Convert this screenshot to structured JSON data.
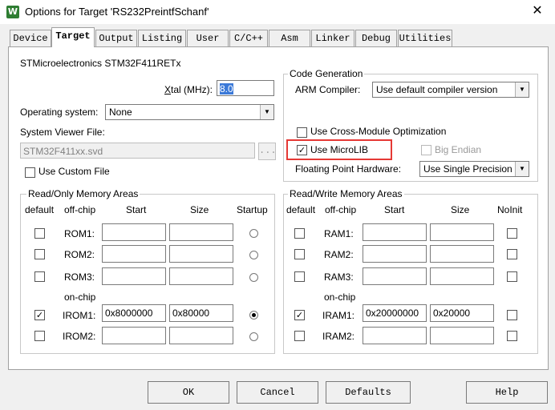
{
  "window": {
    "title": "Options for Target 'RS232PreintfSchanf'",
    "icon": "uvision-icon",
    "close": "✕"
  },
  "tabs": [
    "Device",
    "Target",
    "Output",
    "Listing",
    "User",
    "C/C++",
    "Asm",
    "Linker",
    "Debug",
    "Utilities"
  ],
  "active_tab": "Target",
  "device_name": "STMicroelectronics STM32F411RETx",
  "xtal": {
    "label": "Xtal (MHz):",
    "value": "8.0"
  },
  "os": {
    "label": "Operating system:",
    "value": "None"
  },
  "sysview": {
    "label": "System Viewer File:",
    "value": "STM32F411xx.svd",
    "browse": "..."
  },
  "custom_file": {
    "label": "Use Custom File",
    "checked": false
  },
  "codegen": {
    "title": "Code Generation",
    "compiler_label": "ARM Compiler:",
    "compiler_value": "Use default compiler version",
    "cross_module": {
      "label": "Use Cross-Module Optimization",
      "checked": false
    },
    "microlib": {
      "label": "Use MicroLIB",
      "checked": true,
      "check_mark": "✓"
    },
    "big_endian": {
      "label": "Big Endian",
      "checked": false
    },
    "fp_label": "Floating Point Hardware:",
    "fp_value": "Use Single Precision"
  },
  "rom": {
    "title": "Read/Only Memory Areas",
    "headers": {
      "default": "default",
      "offchip": "off-chip",
      "start": "Start",
      "size": "Size",
      "startup": "Startup"
    },
    "onchip_label": "on-chip",
    "rows": [
      {
        "name": "ROM1:",
        "default": false,
        "start": "",
        "size": "",
        "startup": false
      },
      {
        "name": "ROM2:",
        "default": false,
        "start": "",
        "size": "",
        "startup": false
      },
      {
        "name": "ROM3:",
        "default": false,
        "start": "",
        "size": "",
        "startup": false
      },
      {
        "name": "IROM1:",
        "default": true,
        "start": "0x8000000",
        "size": "0x80000",
        "startup": true
      },
      {
        "name": "IROM2:",
        "default": false,
        "start": "",
        "size": "",
        "startup": false
      }
    ]
  },
  "ram": {
    "title": "Read/Write Memory Areas",
    "headers": {
      "default": "default",
      "offchip": "off-chip",
      "start": "Start",
      "size": "Size",
      "noinit": "NoInit"
    },
    "onchip_label": "on-chip",
    "rows": [
      {
        "name": "RAM1:",
        "default": false,
        "start": "",
        "size": "",
        "noinit": false
      },
      {
        "name": "RAM2:",
        "default": false,
        "start": "",
        "size": "",
        "noinit": false
      },
      {
        "name": "RAM3:",
        "default": false,
        "start": "",
        "size": "",
        "noinit": false
      },
      {
        "name": "IRAM1:",
        "default": true,
        "start": "0x20000000",
        "size": "0x20000",
        "noinit": false
      },
      {
        "name": "IRAM2:",
        "default": false,
        "start": "",
        "size": "",
        "noinit": false
      }
    ]
  },
  "buttons": {
    "ok": "OK",
    "cancel": "Cancel",
    "defaults": "Defaults",
    "help": "Help"
  },
  "colors": {
    "highlight": "#e53935",
    "selection": "#3b79d8"
  }
}
